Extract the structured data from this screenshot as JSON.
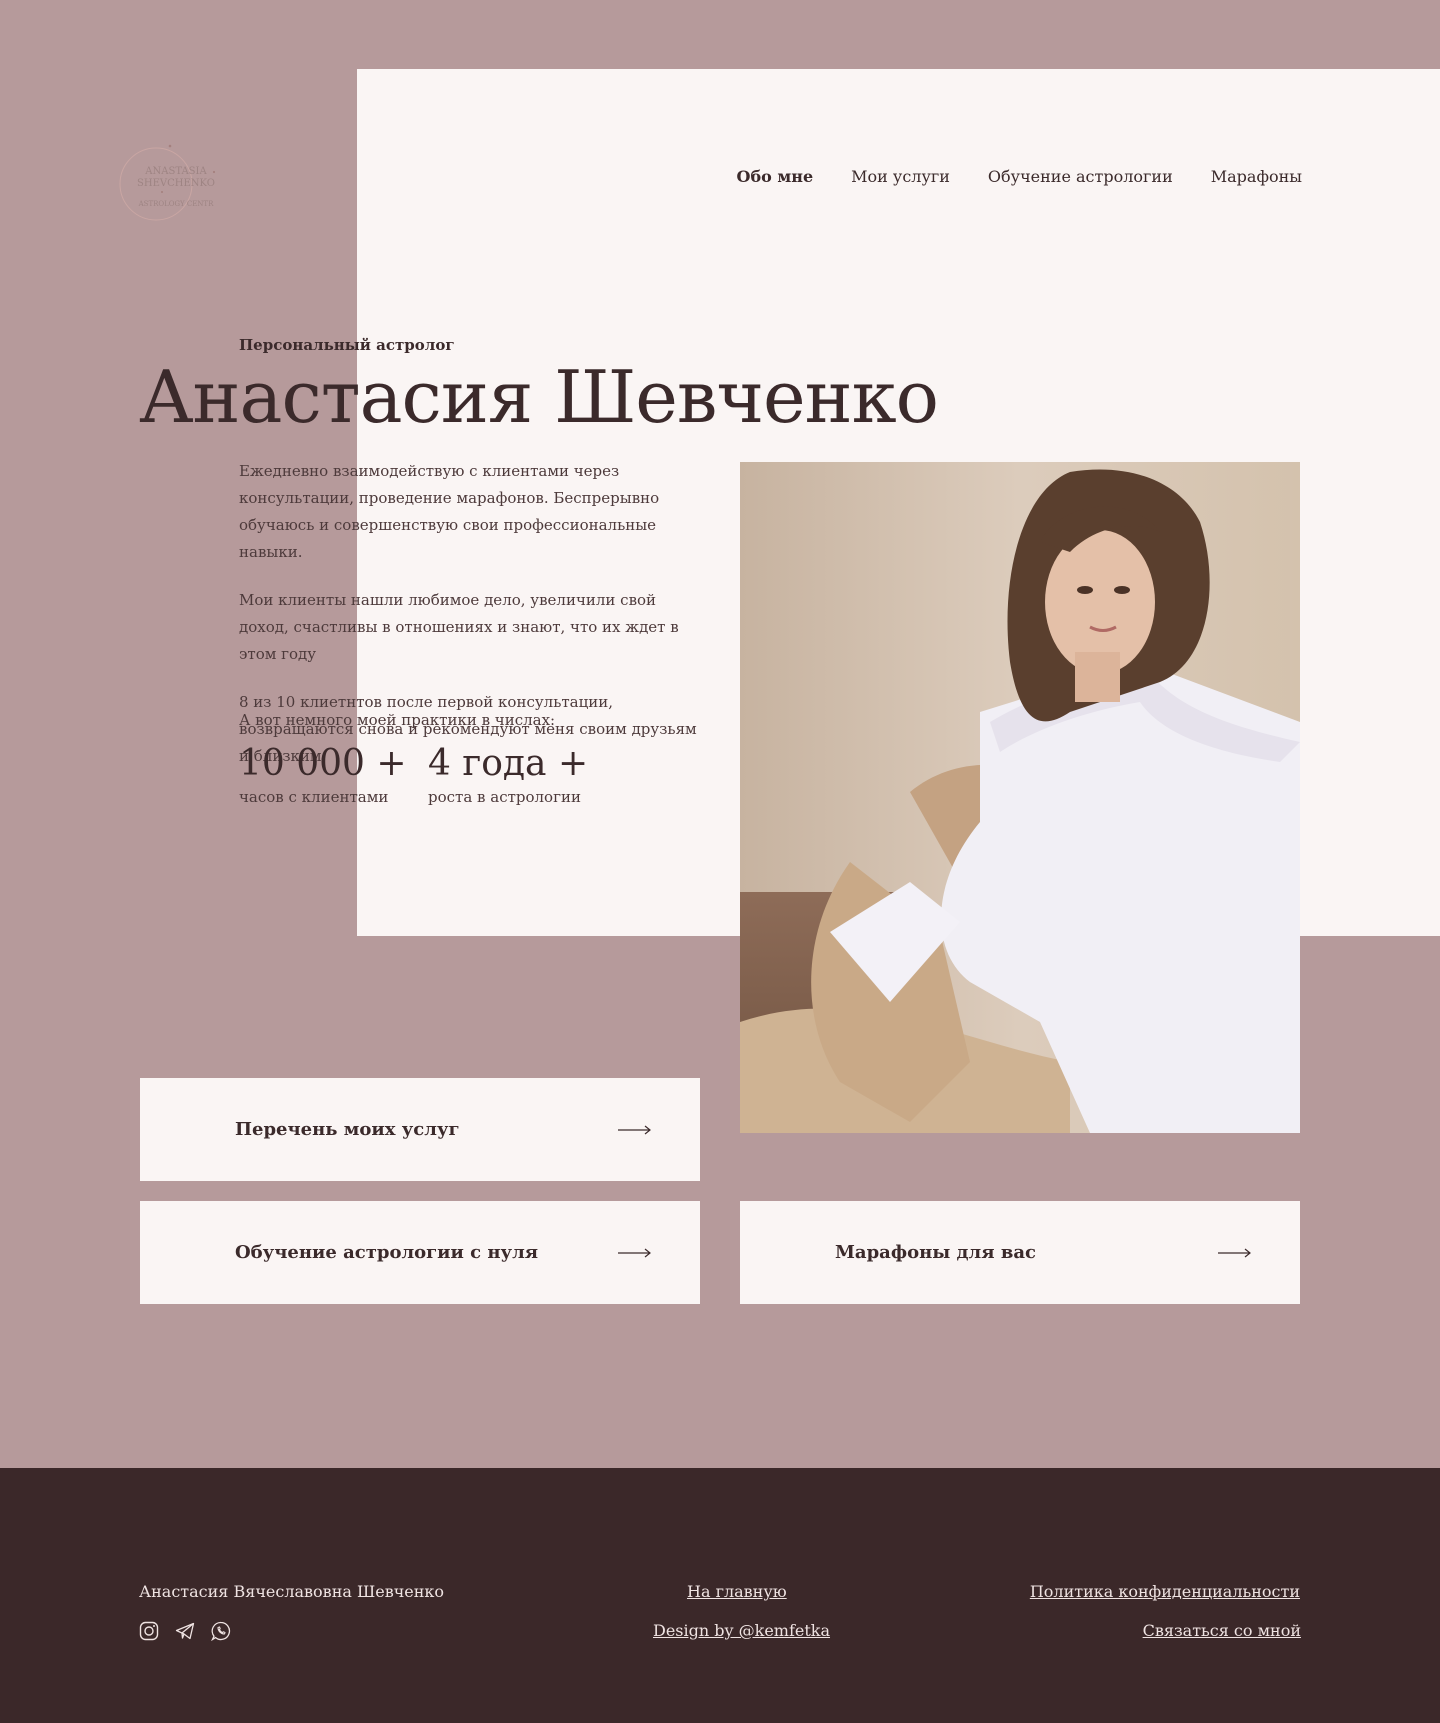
{
  "brand": {
    "logo_line1": "ANASTASIA",
    "logo_line2": "SHEVCHENKO",
    "logo_line3": "ASTROLOGY CENTR"
  },
  "nav": [
    {
      "label": "Обо мне",
      "active": true
    },
    {
      "label": "Мои услуги"
    },
    {
      "label": "Обучение астрологии"
    },
    {
      "label": "Марафоны"
    }
  ],
  "hero": {
    "eyebrow": "Персональный астролог",
    "title": "Анастасия Шевченко",
    "paragraphs": [
      "Ежедневно взаимодействую с клиентами через консультации, проведение марафонов. Беспрерывно обучаюсь и совершенствую свои профессиональные навыки.",
      "Мои клиенты нашли любимое дело, увеличили свой доход, счастливы в отношениях и знают, что их ждет в этом году",
      "8 из 10 клиетнтов после первой консультации, возвращаются снова и рекомендуют меня своим друзьям и близким"
    ],
    "stats_lead": "А вот немного моей практики в числах:",
    "stats": [
      {
        "value": "10 000 +",
        "caption": "часов с клиентами"
      },
      {
        "value": "4 года +",
        "caption": "роста в астрологии"
      }
    ]
  },
  "cards": [
    {
      "label": "Перечень моих услуг"
    },
    {
      "label": "Обучение астрологии с нуля"
    },
    {
      "label": "Марафоны для вас"
    }
  ],
  "footer": {
    "name": "Анастасия Вячеславовна Шевченко",
    "home_link": "На главную",
    "design_link": "Design by @kemfetka",
    "privacy_link": "Политика конфиденциальности",
    "contact_link": "Связаться со мной"
  },
  "colors": {
    "background": "#b69a9b",
    "panel": "#faf5f4",
    "text": "#3b2a2b",
    "footer": "#3b2829"
  }
}
